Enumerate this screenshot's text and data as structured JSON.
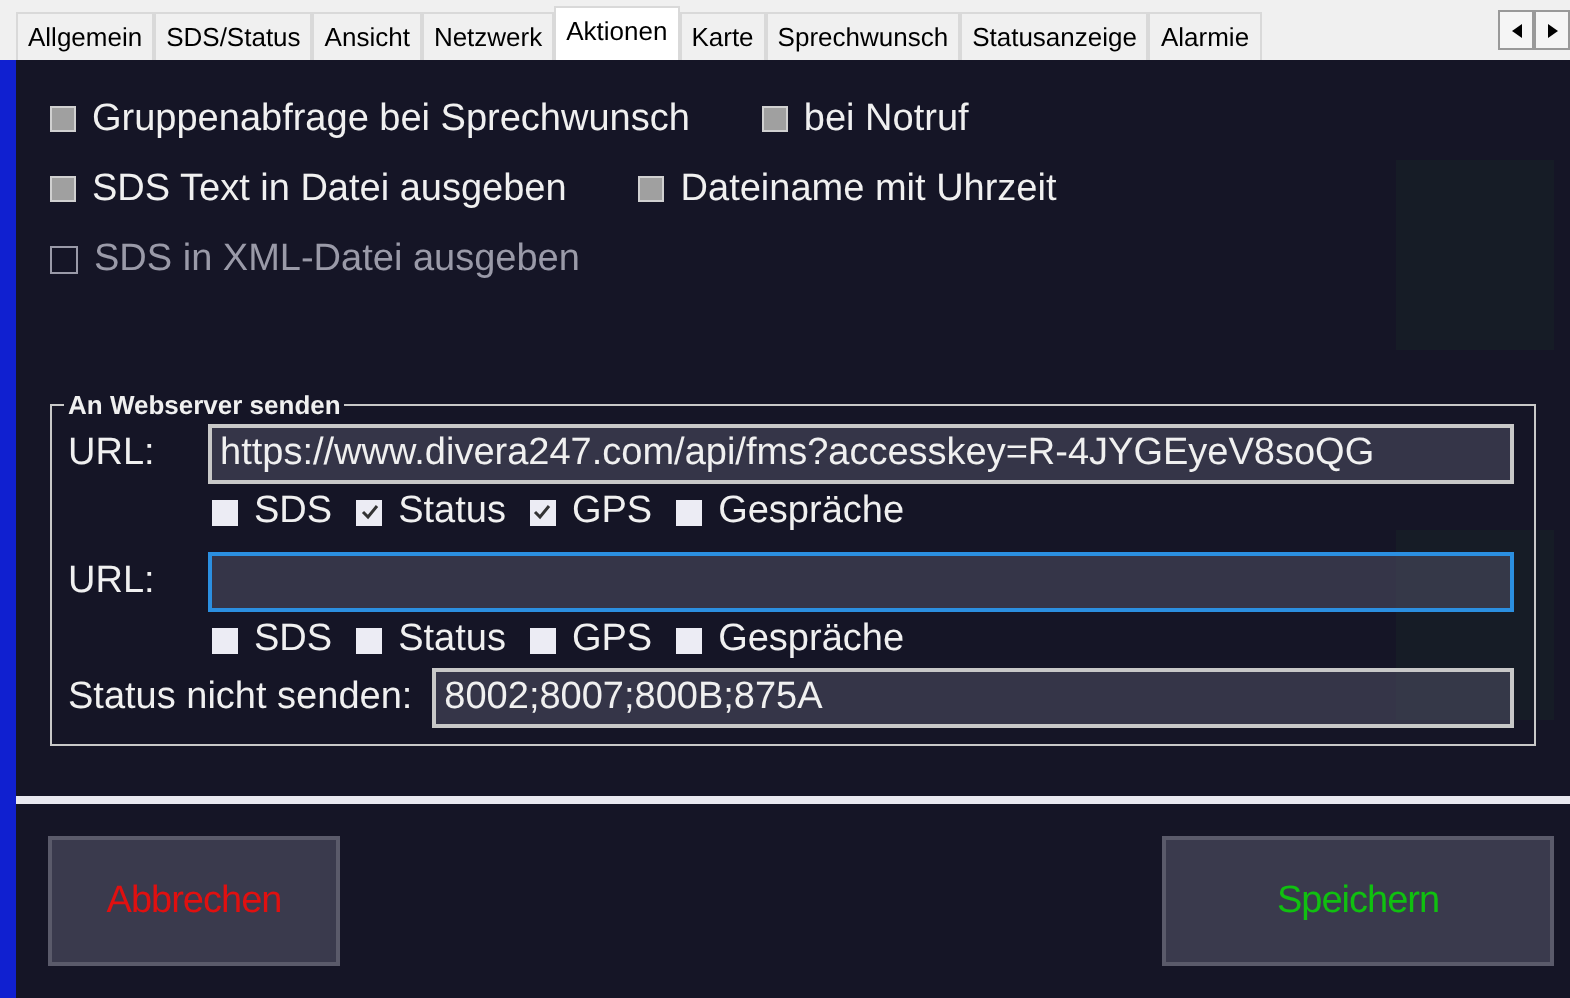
{
  "tabs": [
    {
      "label": "Allgemein",
      "selected": false
    },
    {
      "label": "SDS/Status",
      "selected": false
    },
    {
      "label": "Ansicht",
      "selected": false
    },
    {
      "label": "Netzwerk",
      "selected": false
    },
    {
      "label": "Aktionen",
      "selected": true
    },
    {
      "label": "Karte",
      "selected": false
    },
    {
      "label": "Sprechwunsch",
      "selected": false
    },
    {
      "label": "Statusanzeige",
      "selected": false
    },
    {
      "label": "Alarmie",
      "selected": false
    }
  ],
  "options": [
    [
      {
        "label": "Gruppenabfrage bei Sprechwunsch",
        "checked": false,
        "disabled": false
      },
      {
        "label": "bei Notruf",
        "checked": false,
        "disabled": false
      }
    ],
    [
      {
        "label": "SDS Text in Datei ausgeben",
        "checked": false,
        "disabled": false
      },
      {
        "label": "Dateiname mit Uhrzeit",
        "checked": false,
        "disabled": false
      }
    ],
    [
      {
        "label": "SDS in XML-Datei ausgeben",
        "checked": false,
        "disabled": true
      }
    ]
  ],
  "webserver": {
    "title": "An Webserver senden",
    "targets": [
      {
        "url_label": "URL:",
        "url": "https://www.divera247.com/api/fms?accesskey=R-4JYGEyeV8soQG",
        "focused": false,
        "filters": [
          {
            "label": "SDS",
            "checked": false
          },
          {
            "label": "Status",
            "checked": true
          },
          {
            "label": "GPS",
            "checked": true
          },
          {
            "label": "Gespräche",
            "checked": false
          }
        ]
      },
      {
        "url_label": "URL:",
        "focused": true,
        "filters": [
          {
            "label": "SDS",
            "checked": false
          },
          {
            "label": "Status",
            "checked": false
          },
          {
            "label": "GPS",
            "checked": false
          },
          {
            "label": "Gespräche",
            "checked": false
          }
        ]
      }
    ],
    "exclude_label": "Status nicht senden:",
    "exclude_value": "8002;8007;800B;875A"
  },
  "buttons": [
    {
      "label": "Abbrechen",
      "kind": "cancel"
    },
    {
      "label": "Speichern",
      "kind": "save"
    }
  ]
}
